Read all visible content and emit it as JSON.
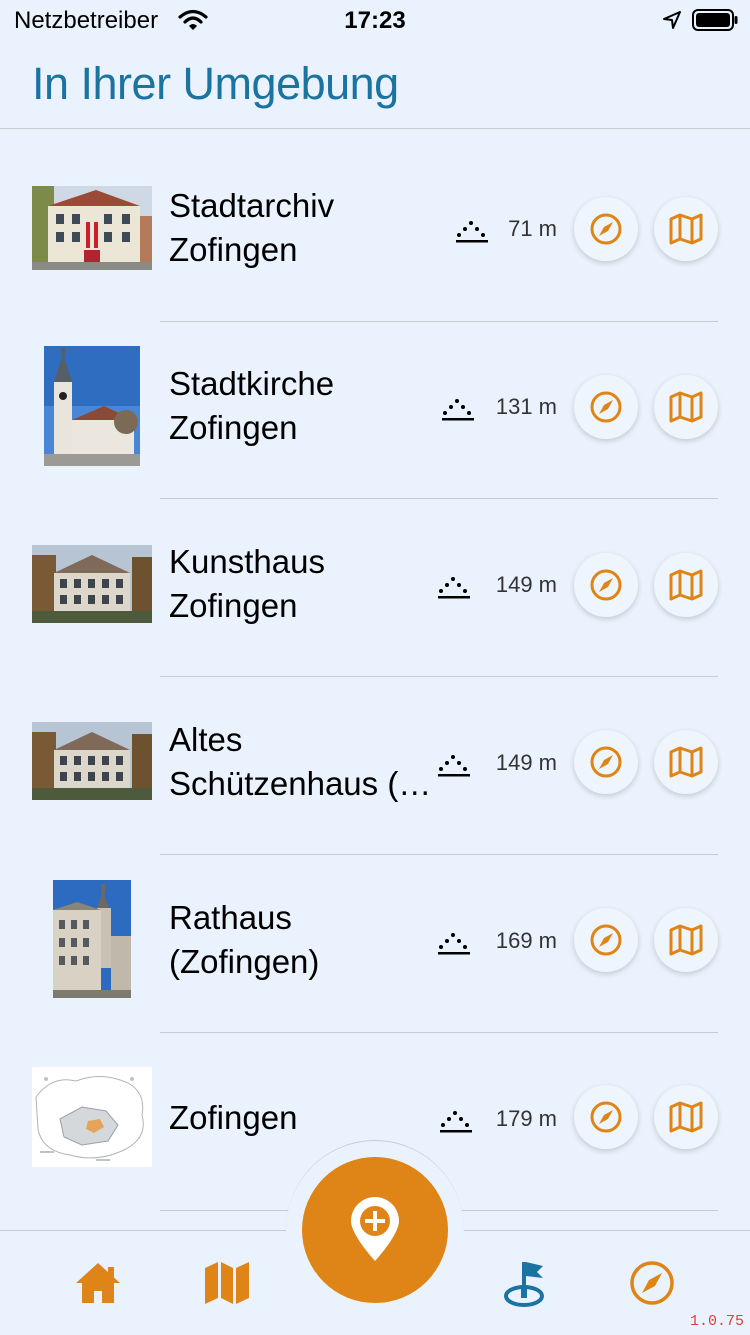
{
  "status_bar": {
    "carrier": "Netzbetreiber",
    "time": "17:23"
  },
  "header": {
    "title": "In Ihrer Umgebung"
  },
  "places": [
    {
      "name_line1": "Stadtarchiv",
      "name_line2": "Zofingen",
      "distance": "71 m"
    },
    {
      "name_line1": "Stadtkirche",
      "name_line2": "Zofingen",
      "distance": "131 m"
    },
    {
      "name_line1": "Kunsthaus",
      "name_line2": "Zofingen",
      "distance": "149 m"
    },
    {
      "name_line1": "Altes",
      "name_line2": "Schützenhaus (…",
      "distance": "149 m"
    },
    {
      "name_line1": "Rathaus",
      "name_line2": "(Zofingen)",
      "distance": "169 m"
    },
    {
      "name_line1": "Zofingen",
      "name_line2": "",
      "distance": "179 m"
    }
  ],
  "icons": {
    "row_actions": [
      "compass-icon",
      "map-icon"
    ],
    "tabs": [
      "home-icon",
      "map-icon",
      "add-location-icon",
      "tour-flag-icon",
      "compass-icon"
    ]
  },
  "colors": {
    "accent": "#df8416",
    "title": "#1a73a0",
    "tour_icon": "#1a73a0",
    "background": "#eaf3fd"
  },
  "version": "1.0.75"
}
